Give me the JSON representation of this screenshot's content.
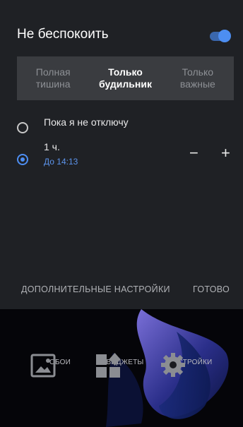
{
  "dnd": {
    "title": "Не беспокоить",
    "enabled": true,
    "modes": [
      {
        "label": "Полная\nтишина",
        "active": false
      },
      {
        "label": "Только\nбудильник",
        "active": true
      },
      {
        "label": "Только\nважные",
        "active": false
      }
    ],
    "options": [
      {
        "label": "Пока я не отключу",
        "selected": false
      },
      {
        "label": "1 ч.",
        "sub": "До 14:13",
        "selected": true
      }
    ],
    "stepper": {
      "minus": "−",
      "plus": "+"
    },
    "more_settings": "ДОПОЛНИТЕЛЬНЫЕ НАСТРОЙКИ",
    "done": "ГОТОВО"
  },
  "home": {
    "actions": [
      {
        "label": "ОБОИ",
        "icon": "image-icon"
      },
      {
        "label": "ВИДЖЕТЫ",
        "icon": "widgets-icon"
      },
      {
        "label": "НАСТРОЙКИ",
        "icon": "gear-icon"
      }
    ]
  },
  "colors": {
    "accent": "#4d8ef2",
    "panel_bg": "#1f2125",
    "mode_bar_bg": "#3a3c40"
  }
}
